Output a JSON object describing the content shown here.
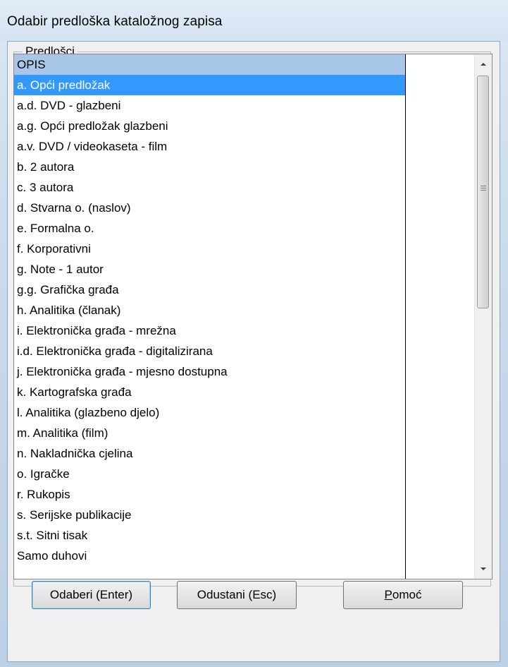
{
  "window": {
    "title": "Odabir predloška kataložnog zapisa"
  },
  "group": {
    "legend": "Predlošci"
  },
  "list": {
    "header": "OPIS",
    "items": [
      "a. Opći predložak",
      "a.d. DVD - glazbeni",
      "a.g. Opći predložak glazbeni",
      "a.v. DVD / videokaseta - film",
      "b. 2 autora",
      "c. 3 autora",
      "d. Stvarna o. (naslov)",
      "e. Formalna o.",
      "f. Korporativni",
      "g. Note - 1 autor",
      "g.g. Grafička građa",
      "h. Analitika (članak)",
      "i. Elektronička građa - mrežna",
      "i.d. Elektronička građa - digitalizirana",
      "j. Elektronička građa - mjesno dostupna",
      "k. Kartografska građa",
      "l. Analitika (glazbeno djelo)",
      "m. Analitika (film)",
      "n. Nakladnička cjelina",
      "o. Igračke",
      "r. Rukopis",
      "s. Serijske publikacije",
      "s.t. Sitni tisak",
      "Samo duhovi"
    ],
    "selected_index": 0
  },
  "buttons": {
    "ok": "Odaberi (Enter)",
    "cancel": "Odustani (Esc)",
    "help_mnemonic": "P",
    "help_rest": "omoć"
  },
  "colors": {
    "selection": "#3399ff",
    "header_bg": "#a8c6e8"
  }
}
